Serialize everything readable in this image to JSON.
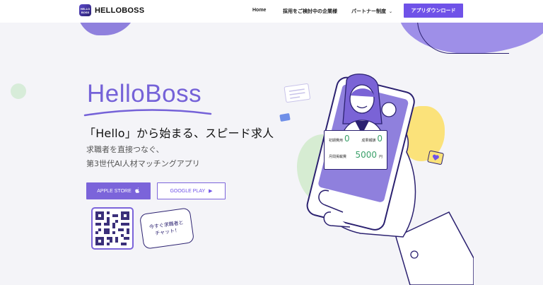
{
  "header": {
    "logo_mark": "HELLO\nBOSS",
    "logo_text": "HELLOBOSS",
    "nav": [
      {
        "label": "Home"
      },
      {
        "label": "採用をご検討中の企業様"
      },
      {
        "label": "パートナー制度"
      }
    ],
    "cta_label": "アプリダウンロード"
  },
  "hero": {
    "brand": "HelloBoss",
    "title": "「Hello」から始まる、スピード求人",
    "subtitle_line1": "求職者を直接つなぐ、",
    "subtitle_line2": "第3世代AI人材マッチングアプリ",
    "apple_label": "APPLE STORE",
    "google_label": "GOOGLE PLAY",
    "bubble_line1": "今すぐ求職者と",
    "bubble_line2": "チャット！"
  },
  "card": {
    "initial_fee_label": "初期費用",
    "initial_fee_value": "0",
    "success_fee_label": "成果報酬",
    "success_fee_value": "0",
    "monthly_label": "月間掲載費",
    "monthly_value": "5000",
    "monthly_unit": "円"
  },
  "colors": {
    "accent": "#6f52e8",
    "brand_purple": "#7562d8",
    "dark_navy": "#2b2170",
    "value_green": "#3ba06a",
    "blob_yellow": "#fbe27a",
    "blob_green": "#d6ecd2"
  },
  "icons": {
    "apple": "apple-icon",
    "google_play": "play-icon",
    "nav_dropdown": "chevron-down-icon"
  }
}
